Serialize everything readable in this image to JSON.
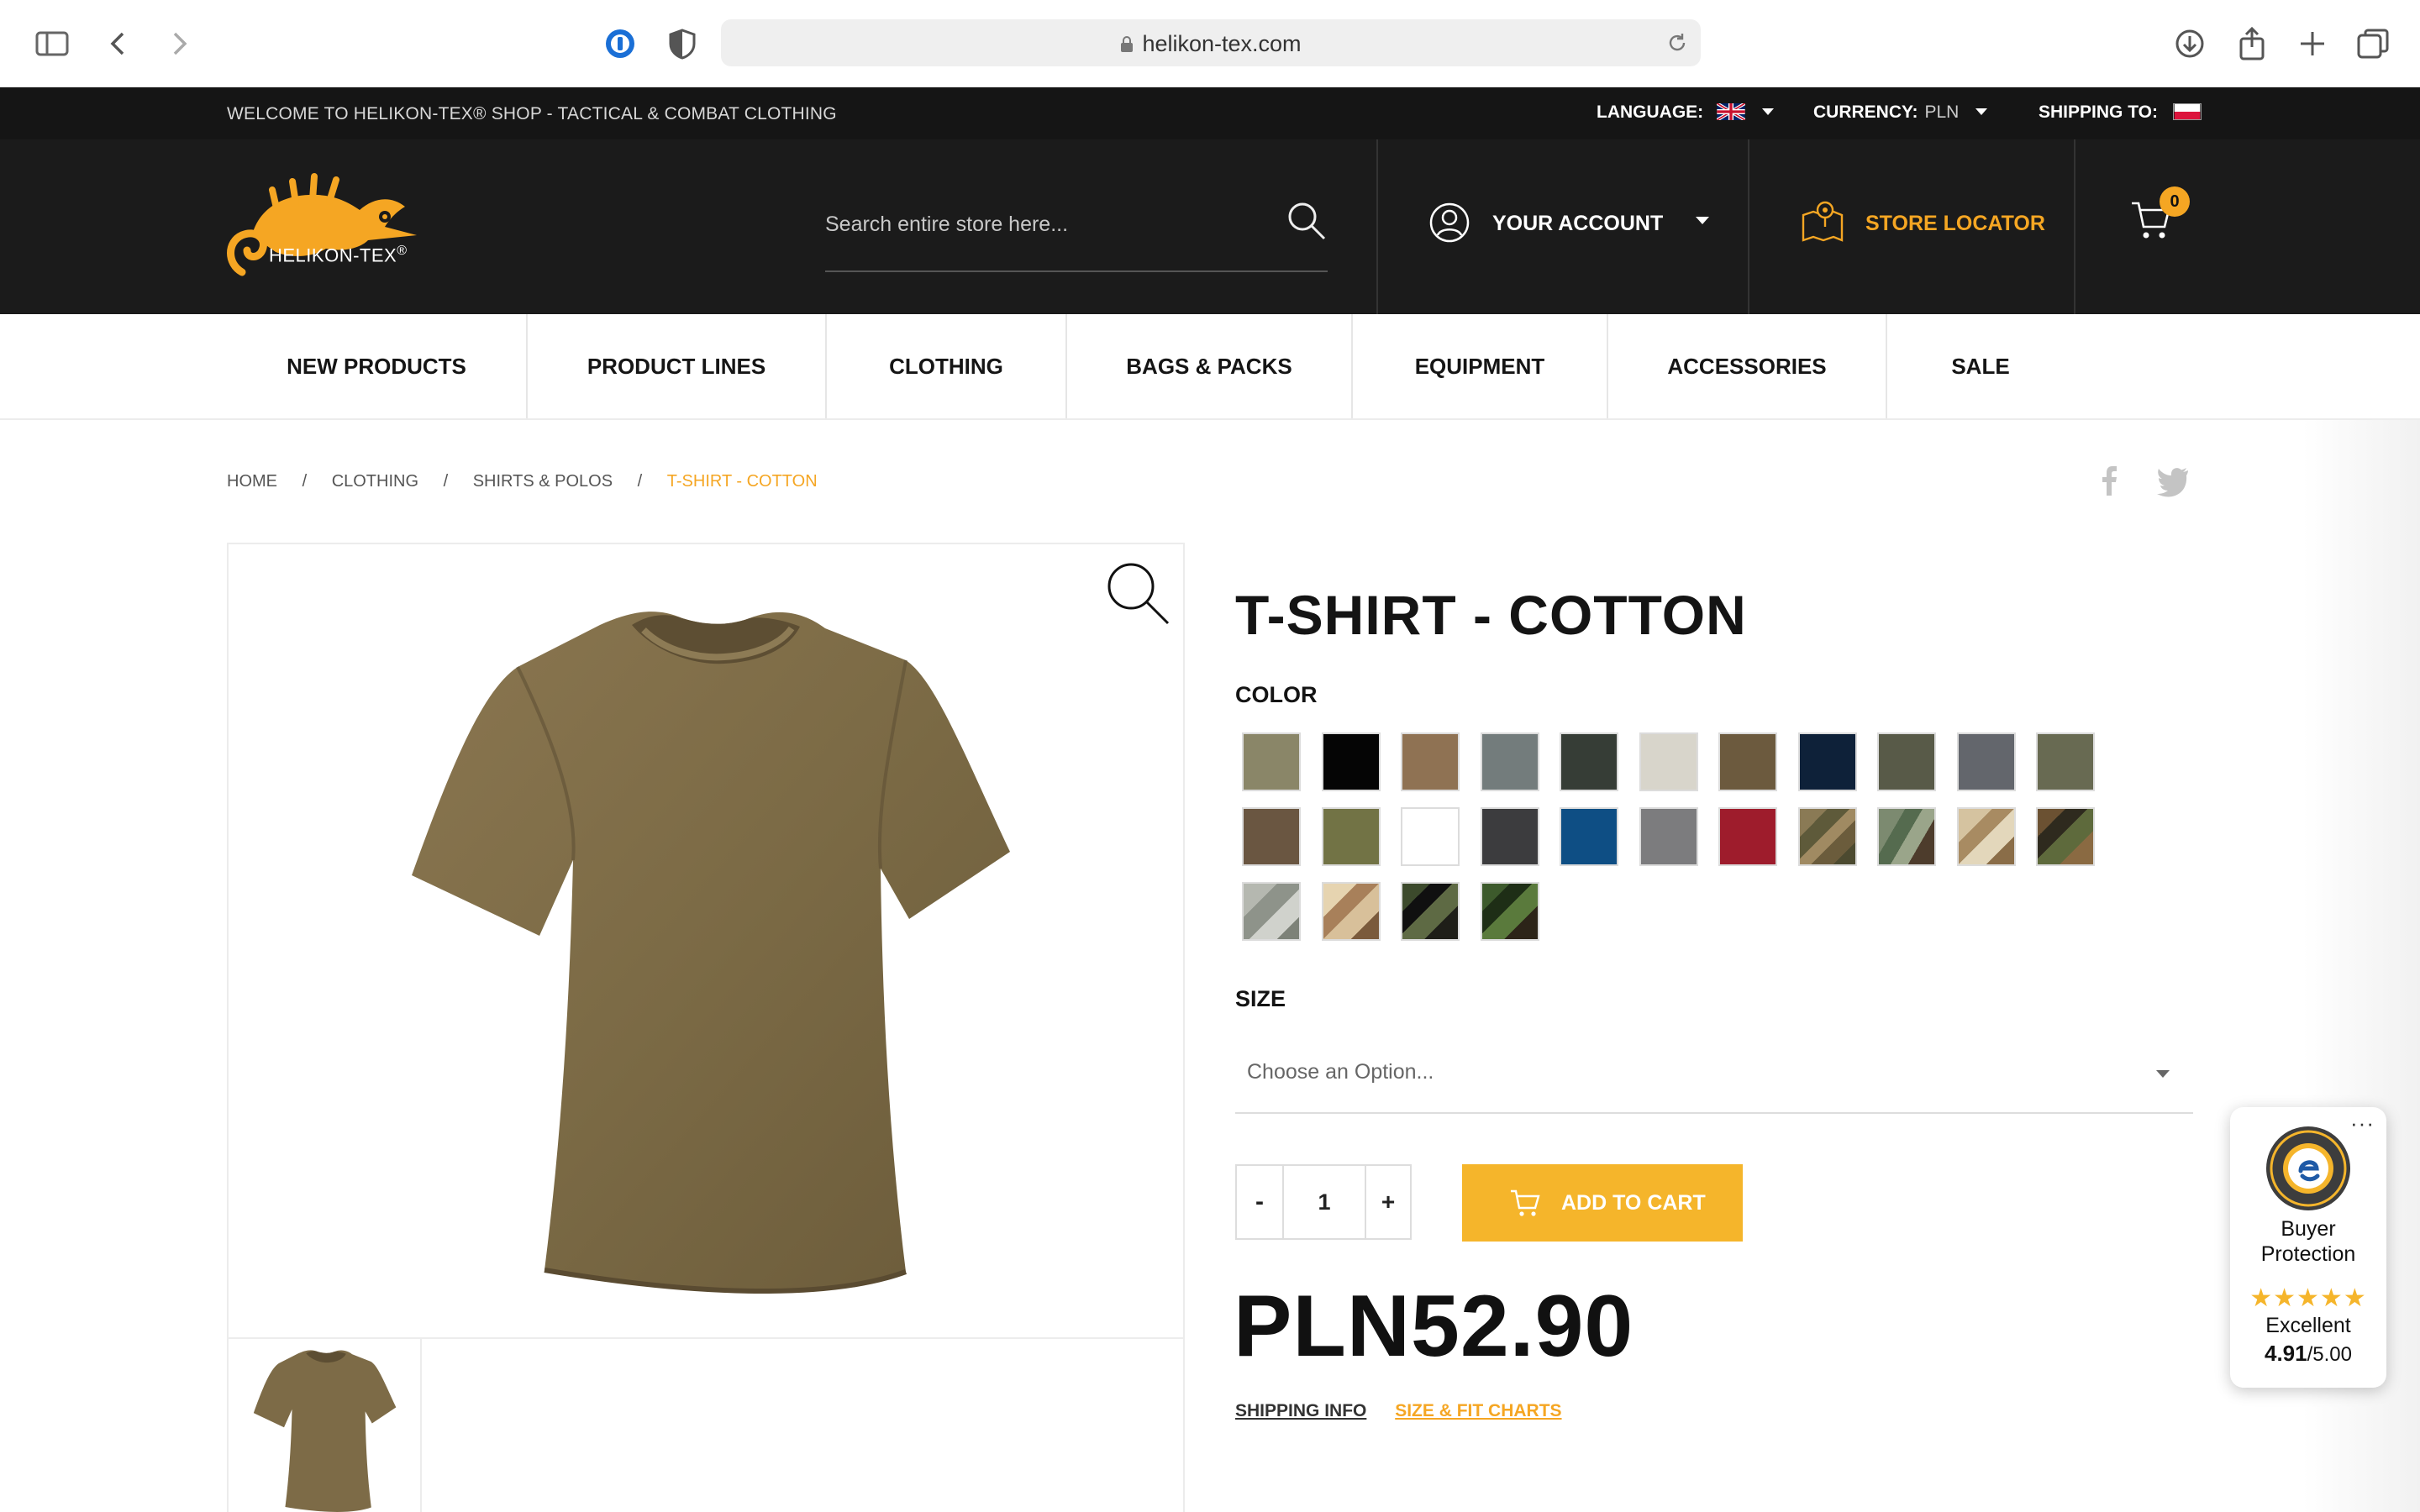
{
  "browser": {
    "url": "helikon-tex.com"
  },
  "top_strip": {
    "welcome": "WELCOME TO HELIKON-TEX® SHOP - TACTICAL & COMBAT CLOTHING",
    "language_label": "LANGUAGE:",
    "currency_label": "CURRENCY:",
    "currency_value": "PLN",
    "shipping_label": "SHIPPING TO:"
  },
  "header": {
    "logo_text": "HELIKON-TEX",
    "search_placeholder": "Search entire store here...",
    "account_label": "YOUR ACCOUNT",
    "store_locator_label": "STORE LOCATOR",
    "cart_count": "0"
  },
  "nav": {
    "items": [
      "NEW PRODUCTS",
      "PRODUCT LINES",
      "CLOTHING",
      "BAGS & PACKS",
      "EQUIPMENT",
      "ACCESSORIES",
      "SALE"
    ]
  },
  "breadcrumb": {
    "items": [
      "HOME",
      "CLOTHING",
      "SHIRTS & POLOS"
    ],
    "separator": "/",
    "current": "T-SHIRT - COTTON"
  },
  "product": {
    "title": "T-SHIRT - COTTON",
    "color_label": "COLOR",
    "colors": [
      "#8a8668",
      "#050505",
      "#8f7253",
      "#737c7c",
      "#363d36",
      "#d8d5cb",
      "#6c5a3e",
      "#0e2139",
      "#585a48",
      "#63666c",
      "#686a52",
      "#6a5641",
      "#727345",
      "#ffffff",
      "#3c3c3e",
      "#0e4e84",
      "#7c7c7e",
      "#9e1c2c",
      "camo-multicam",
      "camo-mandrake",
      "camo-pencott-sandstorm",
      "camo-woodland",
      "camo-acu",
      "camo-desert",
      "camo-black-woodland",
      "camo-digital-woodland"
    ],
    "size_label": "SIZE",
    "size_placeholder": "Choose an Option...",
    "quantity": "1",
    "qty_minus": "-",
    "qty_plus": "+",
    "add_to_cart": "ADD TO CART",
    "price": "PLN52.90",
    "shipping_info": "SHIPPING INFO",
    "size_charts": "SIZE & FIT CHARTS"
  },
  "trusted_shops": {
    "more": "···",
    "title_line1": "Buyer",
    "title_line2": "Protection",
    "stars": "★★★★★",
    "rating_word": "Excellent",
    "score": "4.91",
    "score_max": "/5.00"
  }
}
